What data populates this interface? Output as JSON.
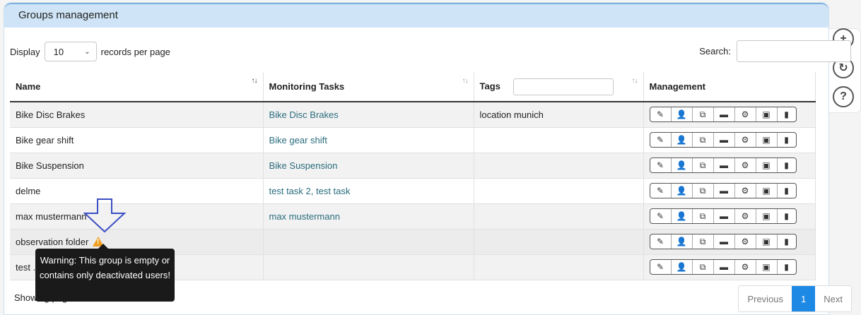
{
  "panel": {
    "title": "Groups management"
  },
  "controls": {
    "display_label": "Display",
    "page_size": "10",
    "records_label": "records per page",
    "search_label": "Search:"
  },
  "table": {
    "headers": [
      "Name",
      "Monitoring Tasks",
      "Tags",
      "Management"
    ],
    "rows": [
      {
        "name": "Bike Disc Brakes",
        "tasks": "Bike Disc Brakes",
        "tags": "location munich"
      },
      {
        "name": "Bike gear shift",
        "tasks": "Bike gear shift",
        "tags": ""
      },
      {
        "name": "Bike Suspension",
        "tasks": "Bike Suspension",
        "tags": ""
      },
      {
        "name": "delme",
        "tasks": "test task 2, test task",
        "tags": ""
      },
      {
        "name": "max mustermann",
        "tasks": "max mustermann",
        "tags": ""
      },
      {
        "name": "observation folder",
        "tasks": "",
        "tags": ""
      },
      {
        "name": "test ..",
        "tasks": "",
        "tags": ""
      }
    ],
    "management_icons": [
      "pencil-icon",
      "user-icon",
      "copy-icon",
      "folder-icon",
      "gear-icon",
      "excel-icon",
      "trash-icon"
    ]
  },
  "tooltip": {
    "text": "Warning: This group is empty or contains only deactivated users!"
  },
  "footer": {
    "info": "Showing page 1 of 1"
  },
  "pager": {
    "previous": "Previous",
    "current": "1",
    "next": "Next"
  },
  "side": {
    "icons": [
      "plus-icon",
      "refresh-icon",
      "help-icon"
    ]
  },
  "colors": {
    "header_bg": "#cfe5f7",
    "link": "#2a6c7d",
    "pager_active": "#1e88e5",
    "warning": "#f0a020",
    "arrow": "#3b4fc4"
  }
}
